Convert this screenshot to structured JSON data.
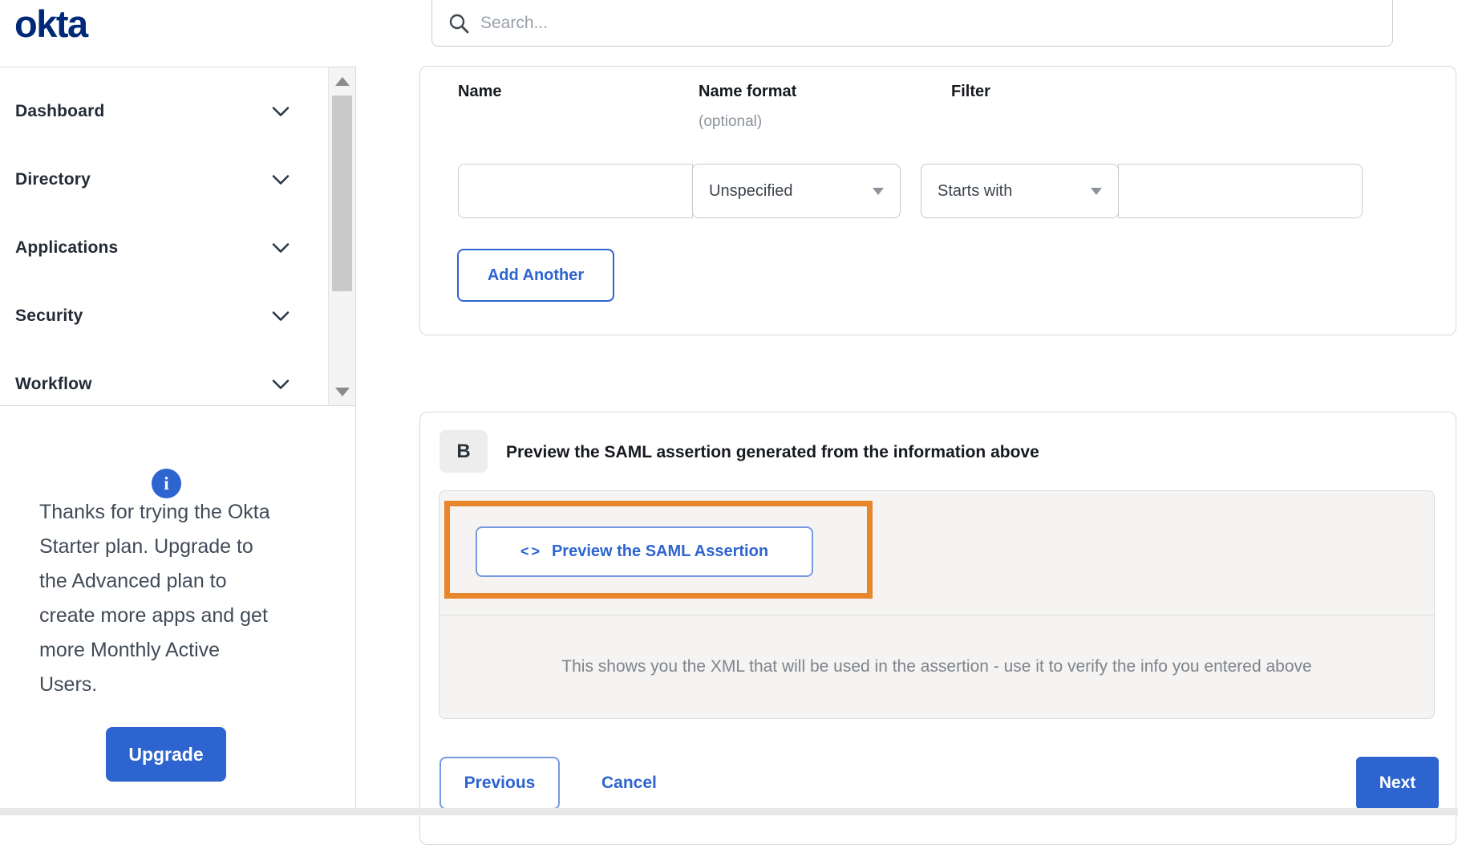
{
  "brand": {
    "logo_text": "okta"
  },
  "header": {
    "search_placeholder": "Search..."
  },
  "sidebar": {
    "items": [
      {
        "label": "Dashboard"
      },
      {
        "label": "Directory"
      },
      {
        "label": "Applications"
      },
      {
        "label": "Security"
      },
      {
        "label": "Workflow"
      }
    ],
    "promo": {
      "info_glyph": "i",
      "text": "Thanks for trying the Okta Starter plan. Upgrade to the Advanced plan to create more apps and get more Monthly Active Users.",
      "upgrade_label": "Upgrade"
    }
  },
  "attribute_form": {
    "name_label": "Name",
    "name_format_label": "Name format",
    "name_format_hint": "(optional)",
    "filter_label": "Filter",
    "name_value": "",
    "name_format_value": "Unspecified",
    "filter_type_value": "Starts with",
    "filter_value": "",
    "add_another_label": "Add Another"
  },
  "preview_section": {
    "badge": "B",
    "title": "Preview the SAML assertion generated from the information above",
    "code_icon": "<>",
    "preview_button_label": "Preview the SAML Assertion",
    "description": "This shows you the XML that will be used in the assertion - use it to verify the info you entered above"
  },
  "wizard_footer": {
    "previous_label": "Previous",
    "cancel_label": "Cancel",
    "next_label": "Next"
  },
  "colors": {
    "accent_blue": "#2e64cf",
    "logo_navy": "#00297a",
    "annotation_orange": "#e8862b"
  }
}
